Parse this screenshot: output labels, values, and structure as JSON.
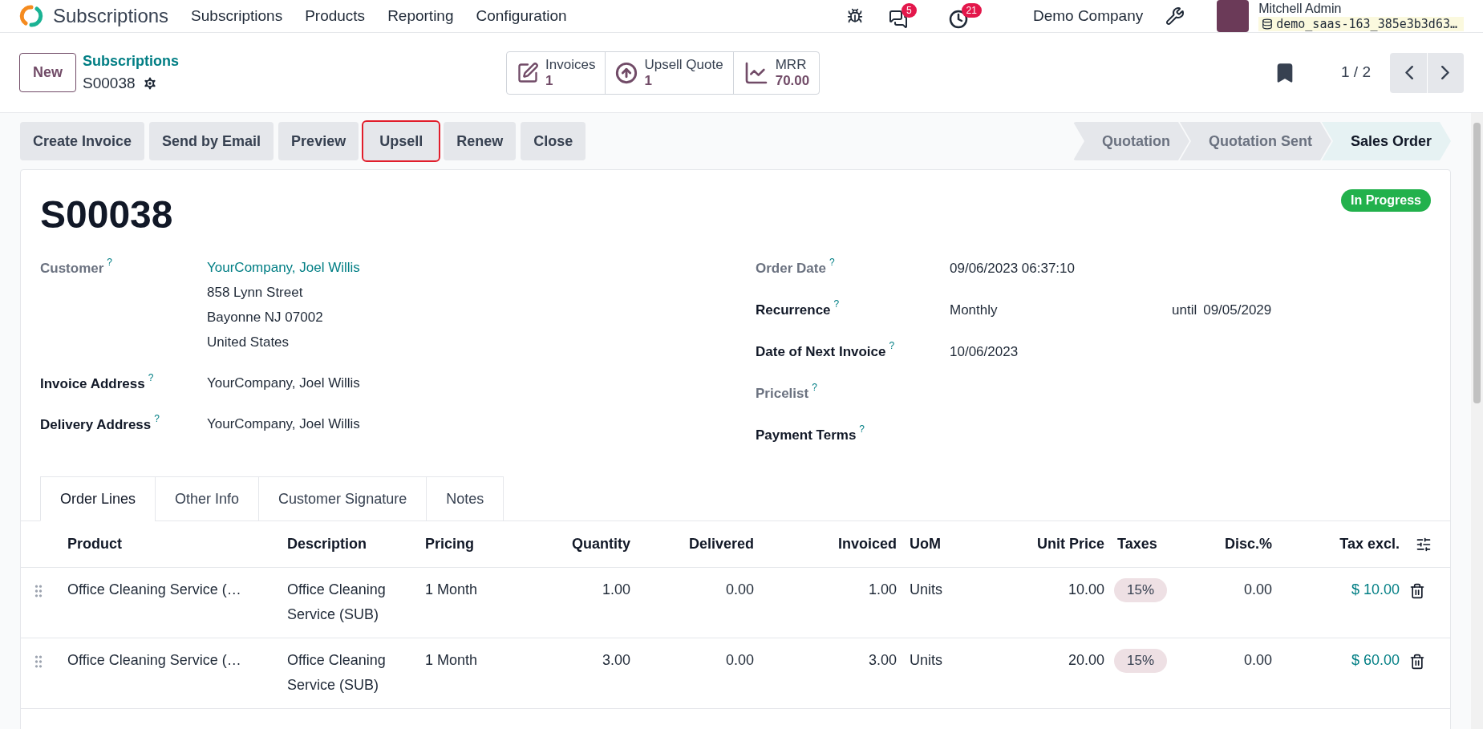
{
  "navbar": {
    "app_name": "Subscriptions",
    "menu": [
      "Subscriptions",
      "Products",
      "Reporting",
      "Configuration"
    ],
    "messages_count": "5",
    "activities_count": "21",
    "company": "Demo Company",
    "user": "Mitchell Admin",
    "database": "demo_saas-163_385e3b3d63…"
  },
  "control_panel": {
    "new_button": "New",
    "breadcrumb": "Subscriptions",
    "record": "S00038",
    "smart_buttons": [
      {
        "kind": "edit",
        "label": "Invoices",
        "value": "1"
      },
      {
        "kind": "upsell",
        "label": "Upsell Quote",
        "value": "1"
      },
      {
        "kind": "chart",
        "label": "MRR",
        "value": "70.00"
      }
    ],
    "pager": "1 / 2"
  },
  "actions": [
    {
      "label": "Create Invoice",
      "highlighted": false
    },
    {
      "label": "Send by Email",
      "highlighted": false
    },
    {
      "label": "Preview",
      "highlighted": false
    },
    {
      "label": "Upsell",
      "highlighted": true
    },
    {
      "label": "Renew",
      "highlighted": false
    },
    {
      "label": "Close",
      "highlighted": false
    }
  ],
  "stages": [
    {
      "label": "Quotation",
      "selected": false
    },
    {
      "label": "Quotation Sent",
      "selected": false
    },
    {
      "label": "Sales Order",
      "selected": true
    }
  ],
  "form": {
    "title": "S00038",
    "status": "In Progress",
    "left_fields": [
      {
        "label": "Customer",
        "help": "?",
        "required": false,
        "value": "YourCompany, Joel Willis",
        "link": true,
        "lines": [
          "858 Lynn Street",
          "Bayonne NJ 07002",
          "United States"
        ]
      },
      {
        "label": "Invoice Address",
        "help": "?",
        "required": true,
        "value": "YourCompany, Joel Willis",
        "link": false
      },
      {
        "label": "Delivery Address",
        "help": "?",
        "required": true,
        "value": "YourCompany, Joel Willis",
        "link": false
      }
    ],
    "right_fields": [
      {
        "label": "Order Date",
        "help": "?",
        "required": false,
        "value": "09/06/2023 06:37:10"
      },
      {
        "label": "Recurrence",
        "help": "?",
        "required": true,
        "value": "Monthly",
        "extra_label": "until",
        "extra_value": "09/05/2029"
      },
      {
        "label": "Date of Next Invoice",
        "help": "?",
        "required": true,
        "value": "10/06/2023"
      },
      {
        "label": "Pricelist",
        "help": "?",
        "required": false
      },
      {
        "label": "Payment Terms",
        "help": "?",
        "required": true
      }
    ]
  },
  "tabs": [
    {
      "label": "Order Lines",
      "selected": true
    },
    {
      "label": "Other Info",
      "selected": false
    },
    {
      "label": "Customer Signature",
      "selected": false
    },
    {
      "label": "Notes",
      "selected": false
    }
  ],
  "table": {
    "columns": [
      "Product",
      "Description",
      "Pricing",
      "Quantity",
      "Delivered",
      "Invoiced",
      "UoM",
      "Unit Price",
      "Taxes",
      "Disc.%",
      "Tax excl."
    ],
    "rows": [
      {
        "product": "Office Cleaning Service (…",
        "description": "Office Cleaning Service (SUB)",
        "pricing": "1 Month",
        "quantity": "1.00",
        "delivered": "0.00",
        "invoiced": "1.00",
        "uom": "Units",
        "unit_price": "10.00",
        "tax": "15%",
        "discount": "0.00",
        "subtotal": "$ 10.00"
      },
      {
        "product": "Office Cleaning Service (…",
        "description": "Office Cleaning Service (SUB)",
        "pricing": "1 Month",
        "quantity": "3.00",
        "delivered": "0.00",
        "invoiced": "3.00",
        "uom": "Units",
        "unit_price": "20.00",
        "tax": "15%",
        "discount": "0.00",
        "subtotal": "$ 60.00"
      }
    ]
  }
}
